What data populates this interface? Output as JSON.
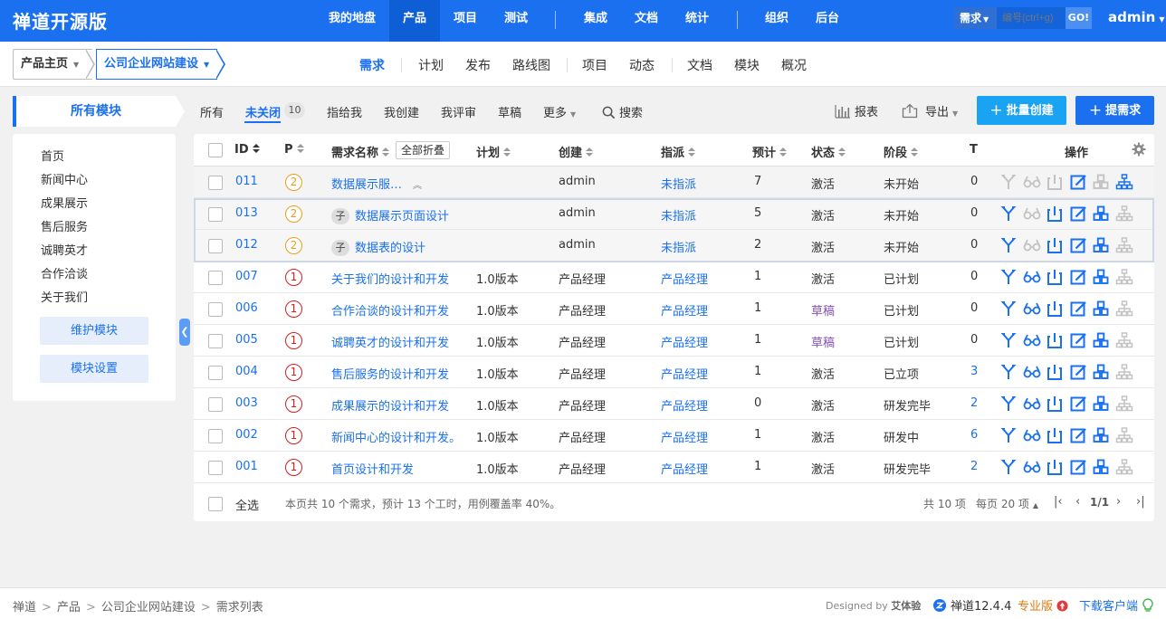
{
  "app": {
    "brand": "禅道开源版"
  },
  "topnav": {
    "items": [
      "我的地盘",
      "产品",
      "项目",
      "测试",
      "集成",
      "文档",
      "统计",
      "组织",
      "后台"
    ],
    "active": "产品",
    "search_type": "需求",
    "search_placeholder": "编号(ctrl+g)",
    "go_label": "GO!",
    "user": "admin"
  },
  "subnav": {
    "product_home": "产品主页",
    "current_product": "公司企业网站建设",
    "tabs": [
      "需求",
      "计划",
      "发布",
      "路线图",
      "项目",
      "动态",
      "文档",
      "模块",
      "概况"
    ],
    "active": "需求"
  },
  "sidebar": {
    "title": "所有模块",
    "modules": [
      "首页",
      "新闻中心",
      "成果展示",
      "售后服务",
      "诚聘英才",
      "合作洽谈",
      "关于我们"
    ],
    "maintain_label": "维护模块",
    "settings_label": "模块设置"
  },
  "filters": {
    "tabs": [
      "所有",
      "未关闭",
      "指给我",
      "我创建",
      "我评审",
      "草稿",
      "更多"
    ],
    "active": "未关闭",
    "unclosed_count": "10",
    "search_label": "搜索",
    "report_label": "报表",
    "export_label": "导出",
    "batch_create_label": "批量创建",
    "create_label": "提需求"
  },
  "table": {
    "columns": {
      "id": "ID",
      "pri": "P",
      "title": "需求名称",
      "plan": "计划",
      "creator": "创建",
      "assigned": "指派",
      "estimate": "预计",
      "status": "状态",
      "stage": "阶段",
      "tasks": "T",
      "actions": "操作"
    },
    "fold_all_label": "全部折叠",
    "child_badge": "子",
    "rows": [
      {
        "id": "011",
        "pri": "2",
        "title": "数据展示服…",
        "plan": "",
        "creator": "admin",
        "assigned": "未指派",
        "estimate": "7",
        "status": "激活",
        "stage": "未开始",
        "tasks": "0",
        "kind": "parent"
      },
      {
        "id": "013",
        "pri": "2",
        "title": "数据展示页面设计",
        "plan": "",
        "creator": "admin",
        "assigned": "未指派",
        "estimate": "5",
        "status": "激活",
        "stage": "未开始",
        "tasks": "0",
        "kind": "child"
      },
      {
        "id": "012",
        "pri": "2",
        "title": "数据表的设计",
        "plan": "",
        "creator": "admin",
        "assigned": "未指派",
        "estimate": "2",
        "status": "激活",
        "stage": "未开始",
        "tasks": "0",
        "kind": "child"
      },
      {
        "id": "007",
        "pri": "1",
        "title": "关于我们的设计和开发",
        "plan": "1.0版本",
        "creator": "产品经理",
        "assigned": "产品经理",
        "estimate": "1",
        "status": "激活",
        "stage": "已计划",
        "tasks": "0",
        "kind": "normal"
      },
      {
        "id": "006",
        "pri": "1",
        "title": "合作洽谈的设计和开发",
        "plan": "1.0版本",
        "creator": "产品经理",
        "assigned": "产品经理",
        "estimate": "1",
        "status": "草稿",
        "stage": "已计划",
        "tasks": "0",
        "kind": "normal"
      },
      {
        "id": "005",
        "pri": "1",
        "title": "诚聘英才的设计和开发",
        "plan": "1.0版本",
        "creator": "产品经理",
        "assigned": "产品经理",
        "estimate": "1",
        "status": "草稿",
        "stage": "已计划",
        "tasks": "0",
        "kind": "normal"
      },
      {
        "id": "004",
        "pri": "1",
        "title": "售后服务的设计和开发",
        "plan": "1.0版本",
        "creator": "产品经理",
        "assigned": "产品经理",
        "estimate": "1",
        "status": "激活",
        "stage": "已立项",
        "tasks": "3",
        "kind": "normal"
      },
      {
        "id": "003",
        "pri": "1",
        "title": "成果展示的设计和开发",
        "plan": "1.0版本",
        "creator": "产品经理",
        "assigned": "产品经理",
        "estimate": "0",
        "status": "激活",
        "stage": "研发完毕",
        "tasks": "2",
        "kind": "normal"
      },
      {
        "id": "002",
        "pri": "1",
        "title": "新闻中心的设计和开发。",
        "plan": "1.0版本",
        "creator": "产品经理",
        "assigned": "产品经理",
        "estimate": "1",
        "status": "激活",
        "stage": "研发中",
        "tasks": "6",
        "kind": "normal"
      },
      {
        "id": "001",
        "pri": "1",
        "title": "首页设计和开发",
        "plan": "1.0版本",
        "creator": "产品经理",
        "assigned": "产品经理",
        "estimate": "1",
        "status": "激活",
        "stage": "研发完毕",
        "tasks": "2",
        "kind": "normal"
      }
    ],
    "footer": {
      "select_all": "全选",
      "summary": "本页共 10 个需求，预计 13 个工时，用例覆盖率 40%。",
      "total": "共 10 项",
      "per_page": "每页 20 项",
      "page": "1/1"
    }
  },
  "statusbar": {
    "breadcrumb": [
      "禅道",
      "产品",
      "公司企业网站建设",
      "需求列表"
    ],
    "designed_by_prefix": "Designed by",
    "designed_by_name": "艾体验",
    "version": "禅道12.4.4",
    "pro_label": "专业版",
    "download_label": "下载客户端"
  },
  "colors": {
    "primary": "#1a70ef",
    "accent": "#1aa3f2",
    "pri1": "#d21f1f",
    "pri2": "#ee9a1a",
    "draft": "#8754b9"
  }
}
